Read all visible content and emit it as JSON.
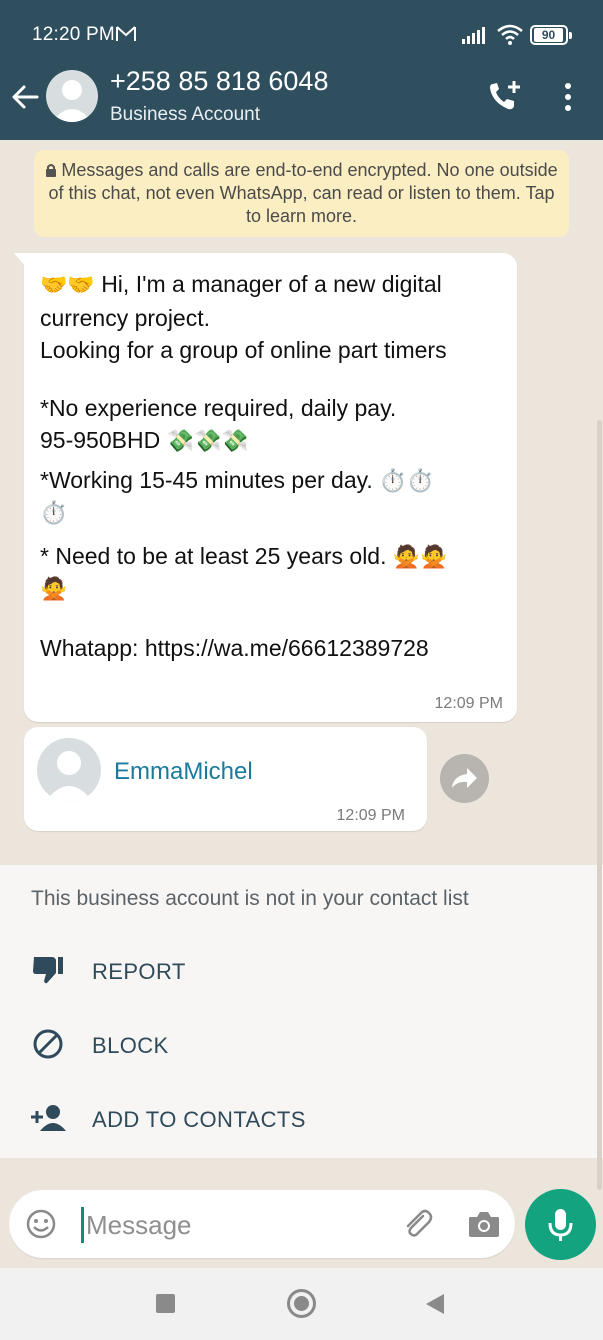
{
  "status_bar": {
    "time": "12:20 PM",
    "battery": "90"
  },
  "header": {
    "title": "+258 85 818 6048",
    "subtitle": "Business Account"
  },
  "encryption_notice": "Messages and calls are end-to-end encrypted. No one outside of this chat, not even WhatsApp, can read or listen to them. Tap to learn more.",
  "messages": [
    {
      "lines": {
        "l1": "Hi, I'm a manager of a new digital",
        "l2": "currency project.",
        "l3": "Looking for a group of online part timers",
        "l4": "*No experience required, daily pay.",
        "l5": "95-950BHD",
        "l6": "*Working 15-45 minutes per day.",
        "l7": "* Need to be at least 25 years old.",
        "l8": "Whatapp:   https://wa.me/66612389728"
      },
      "emoji": {
        "handshakes": "🤝🤝",
        "money": "💸💸💸",
        "timers_a": "⏱️⏱️",
        "timer_b": "⏱️",
        "no_signs_a": "🙅🙅",
        "no_sign_b": "🙅"
      },
      "time": "12:09 PM"
    },
    {
      "contact_name": "EmmaMichel",
      "time": "12:09 PM"
    }
  ],
  "unknown_panel": {
    "note": "This business account is not in your contact list",
    "actions": [
      "REPORT",
      "BLOCK",
      "ADD TO CONTACTS"
    ]
  },
  "composer": {
    "placeholder": "Message"
  },
  "colors": {
    "header": "#2f4f5e",
    "accent": "#14a37f",
    "link": "#1a7a9c"
  }
}
